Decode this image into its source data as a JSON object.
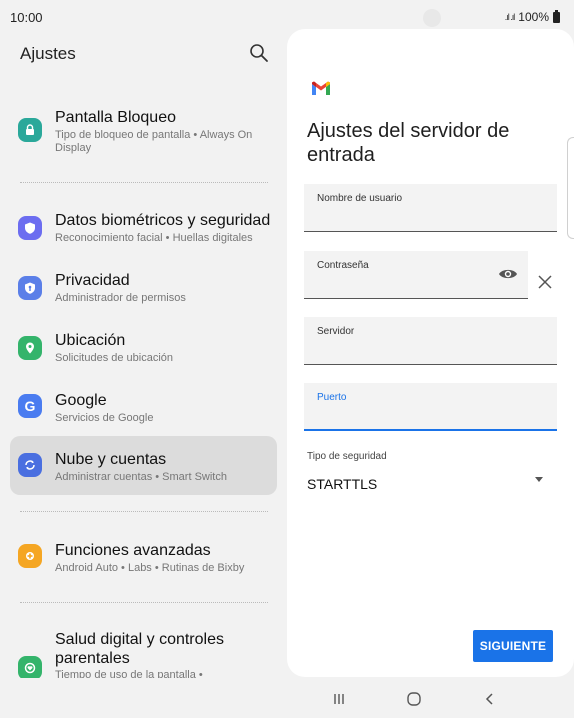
{
  "status_bar": {
    "time": "10:00",
    "signal": ".ıl .ıl",
    "battery": "100%"
  },
  "settings": {
    "title": "Ajustes",
    "items": [
      {
        "title": "Pantalla Bloqueo",
        "subtitle": "Tipo de bloqueo de pantalla  •  Always On Display",
        "icon": "lock-icon",
        "color": "#2aa89a"
      },
      {
        "title": "Datos biométricos y seguridad",
        "subtitle": "Reconocimiento facial  •  Huellas digitales",
        "icon": "shield-icon",
        "color": "#6c6df0"
      },
      {
        "title": "Privacidad",
        "subtitle": "Administrador de permisos",
        "icon": "privacy-icon",
        "color": "#5b7fe8"
      },
      {
        "title": "Ubicación",
        "subtitle": "Solicitudes de ubicación",
        "icon": "location-icon",
        "color": "#34b46b"
      },
      {
        "title": "Google",
        "subtitle": "Servicios de Google",
        "icon": "google-icon",
        "color": "#4a7cf0"
      },
      {
        "title": "Nube y cuentas",
        "subtitle": "Administrar cuentas  •  Smart Switch",
        "icon": "sync-icon",
        "color": "#4a6fe0"
      },
      {
        "title": "Funciones avanzadas",
        "subtitle": "Android Auto  •  Labs  •  Rutinas de Bixby",
        "icon": "gear-plus-icon",
        "color": "#f5a623"
      },
      {
        "title": "Salud digital y controles parentales",
        "subtitle": "Tiempo de uso de la pantalla  •",
        "icon": "wellbeing-icon",
        "color": "#34b46b"
      }
    ]
  },
  "panel": {
    "title": "Ajustes del servidor de entrada",
    "fields": {
      "username": "Nombre de usuario",
      "password": "Contraseña",
      "server": "Servidor",
      "port": "Puerto"
    },
    "security_label": "Tipo de seguridad",
    "security_value": "STARTTLS",
    "next_button": "SIGUIENTE"
  },
  "colors": {
    "accent": "#1a73e8",
    "selected": "#dcdcdc",
    "background": "#f2f2f2"
  }
}
